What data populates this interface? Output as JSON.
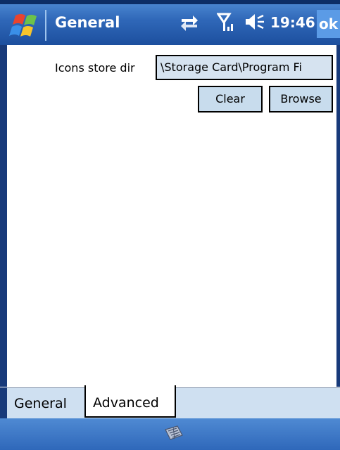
{
  "titlebar": {
    "title": "General",
    "time": "19:46",
    "ok_label": "ok",
    "icons": [
      "windows-start-icon",
      "connectivity-icon",
      "signal-icon",
      "volume-icon"
    ]
  },
  "form": {
    "icons_store_label": "Icons store dir",
    "icons_store_value": "\\Storage Card\\Program Fi",
    "clear_label": "Clear",
    "browse_label": "Browse"
  },
  "tabs": [
    {
      "label": "General",
      "selected": false
    },
    {
      "label": "Advanced",
      "selected": true
    }
  ],
  "menubar": {
    "icon": "keyboard-icon"
  },
  "colors": {
    "title_bar": "#2f67b8",
    "border": "#183a7a",
    "input_bg": "#d6e3f0",
    "button_bg": "#c8dced",
    "tab_bar": "#cfe0f1"
  }
}
